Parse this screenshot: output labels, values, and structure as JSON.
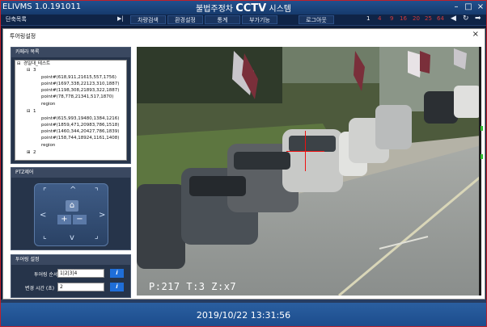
{
  "app": {
    "name": "ELIVMS 1.0.191011",
    "title_prefix": "불법주정차 ",
    "title_cctv": "CCTV",
    "title_suffix": " 시스템",
    "minimize": "–",
    "maximize": "□",
    "close": "×"
  },
  "toolbar": {
    "shortcut_list": "단축목록",
    "arrow": "▶|",
    "menu": [
      "차량검색",
      "환경설정",
      "통계",
      "부가기능",
      "로그아웃"
    ],
    "splits": [
      "1",
      "4",
      "9",
      "16",
      "20",
      "25",
      "64"
    ],
    "active_split": "1",
    "nav": [
      "◀",
      "↻",
      "➡"
    ]
  },
  "dialog": {
    "title": "투어링설정",
    "close": "×"
  },
  "camera_panel": {
    "header": "카메라 목록",
    "tree": {
      "root": "경일대_테스트",
      "nodes": [
        {
          "label": "3",
          "children": [
            "point#(618,911,21615,557,1756)",
            "point#(1697,338,22123,310,1887)",
            "point#(1198,308,21893,322,1887)",
            "point#(78,778,21341,517,1870)",
            "region"
          ]
        },
        {
          "label": "1",
          "children": [
            "point#(615,993,19480,1384,1216)",
            "point#(1859,471,20983,786,1518)",
            "point#(1460,344,20427,786,1839)",
            "point#(158,744,18924,1161,1408)",
            "region"
          ]
        },
        {
          "label": "2",
          "children": []
        }
      ]
    }
  },
  "ptz_panel": {
    "header": "PTZ제어",
    "home_icon": "⌂",
    "zoom_in": "+",
    "zoom_out": "−",
    "arrows": {
      "up": "^",
      "down": "v",
      "left": "<",
      "right": ">",
      "up_left": "⌜",
      "up_right": "⌝",
      "down_left": "⌞",
      "down_right": "⌟"
    }
  },
  "tour_panel": {
    "header": "투어링 설정",
    "order_label": "투어링 순서",
    "order_value": "1|2|3|4",
    "time_label": "변경 시간 (초)",
    "time_value": "2",
    "apply": "i"
  },
  "video": {
    "osd": "P:217 T:3   Z:x7"
  },
  "status": {
    "datetime": "2019/10/22 13:31:56"
  },
  "colors": {
    "accent": "#1f6ed8",
    "frame": "#c0202a",
    "status_bar": "#2a5fa0"
  }
}
